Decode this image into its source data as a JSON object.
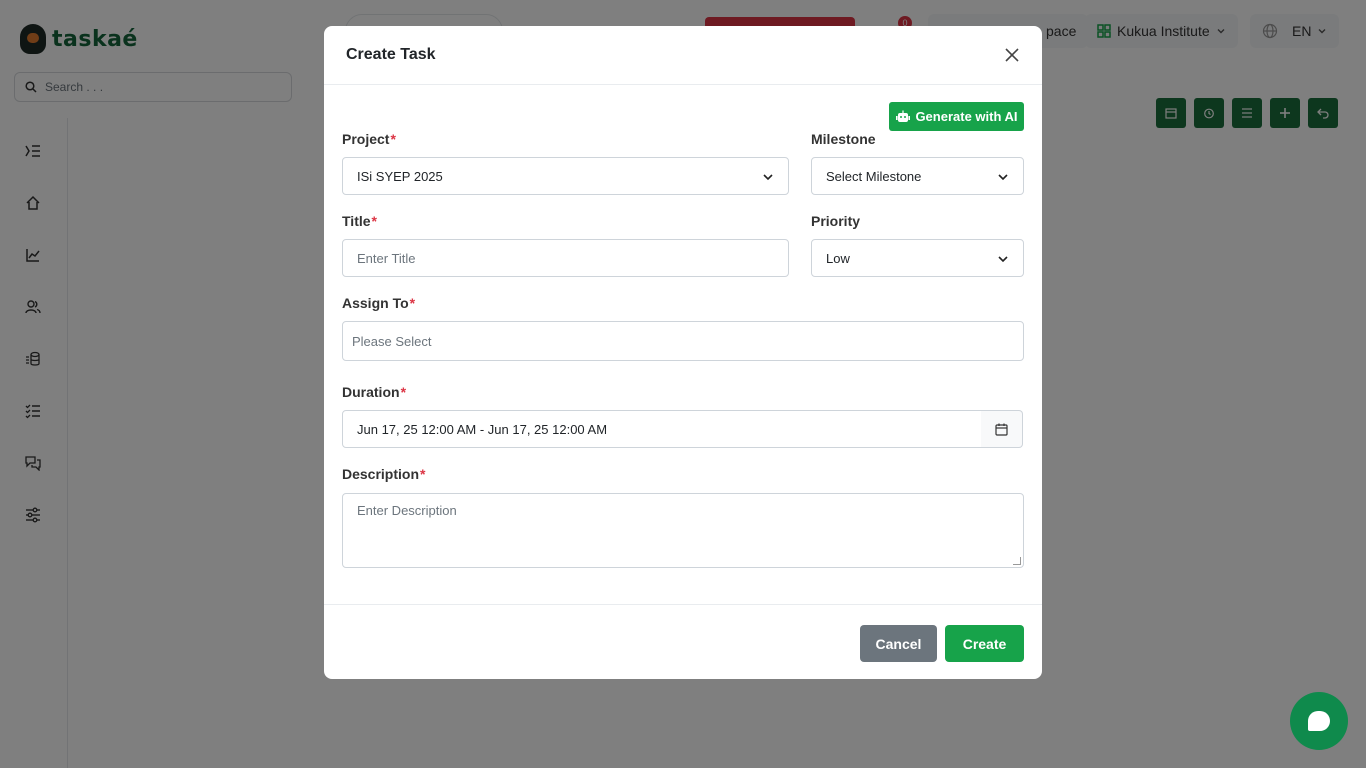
{
  "app": {
    "logo_text": "taskaé",
    "search_placeholder": "Search . . .",
    "notification_count": "0",
    "workspace_label": "pace",
    "org_name": "Kukua Institute",
    "language": "EN"
  },
  "colors": {
    "brand_green": "#17a34a",
    "dark_green": "#1b6e3c",
    "required_red": "#dc3545",
    "cancel_gray": "#6c757d"
  },
  "modal": {
    "title": "Create Task",
    "ai_button_label": "Generate with AI",
    "project": {
      "label": "Project",
      "required": "*",
      "value": "ISi SYEP 2025"
    },
    "milestone": {
      "label": "Milestone",
      "value": "Select Milestone"
    },
    "title_field": {
      "label": "Title",
      "required": "*",
      "placeholder": "Enter Title"
    },
    "priority": {
      "label": "Priority",
      "value": "Low"
    },
    "assign_to": {
      "label": "Assign To",
      "required": "*",
      "placeholder": "Please Select"
    },
    "duration": {
      "label": "Duration",
      "required": "*",
      "value": "Jun 17, 25 12:00 AM - Jun 17, 25 12:00 AM"
    },
    "description": {
      "label": "Description",
      "required": "*",
      "placeholder": "Enter Description"
    },
    "cancel_label": "Cancel",
    "create_label": "Create"
  }
}
